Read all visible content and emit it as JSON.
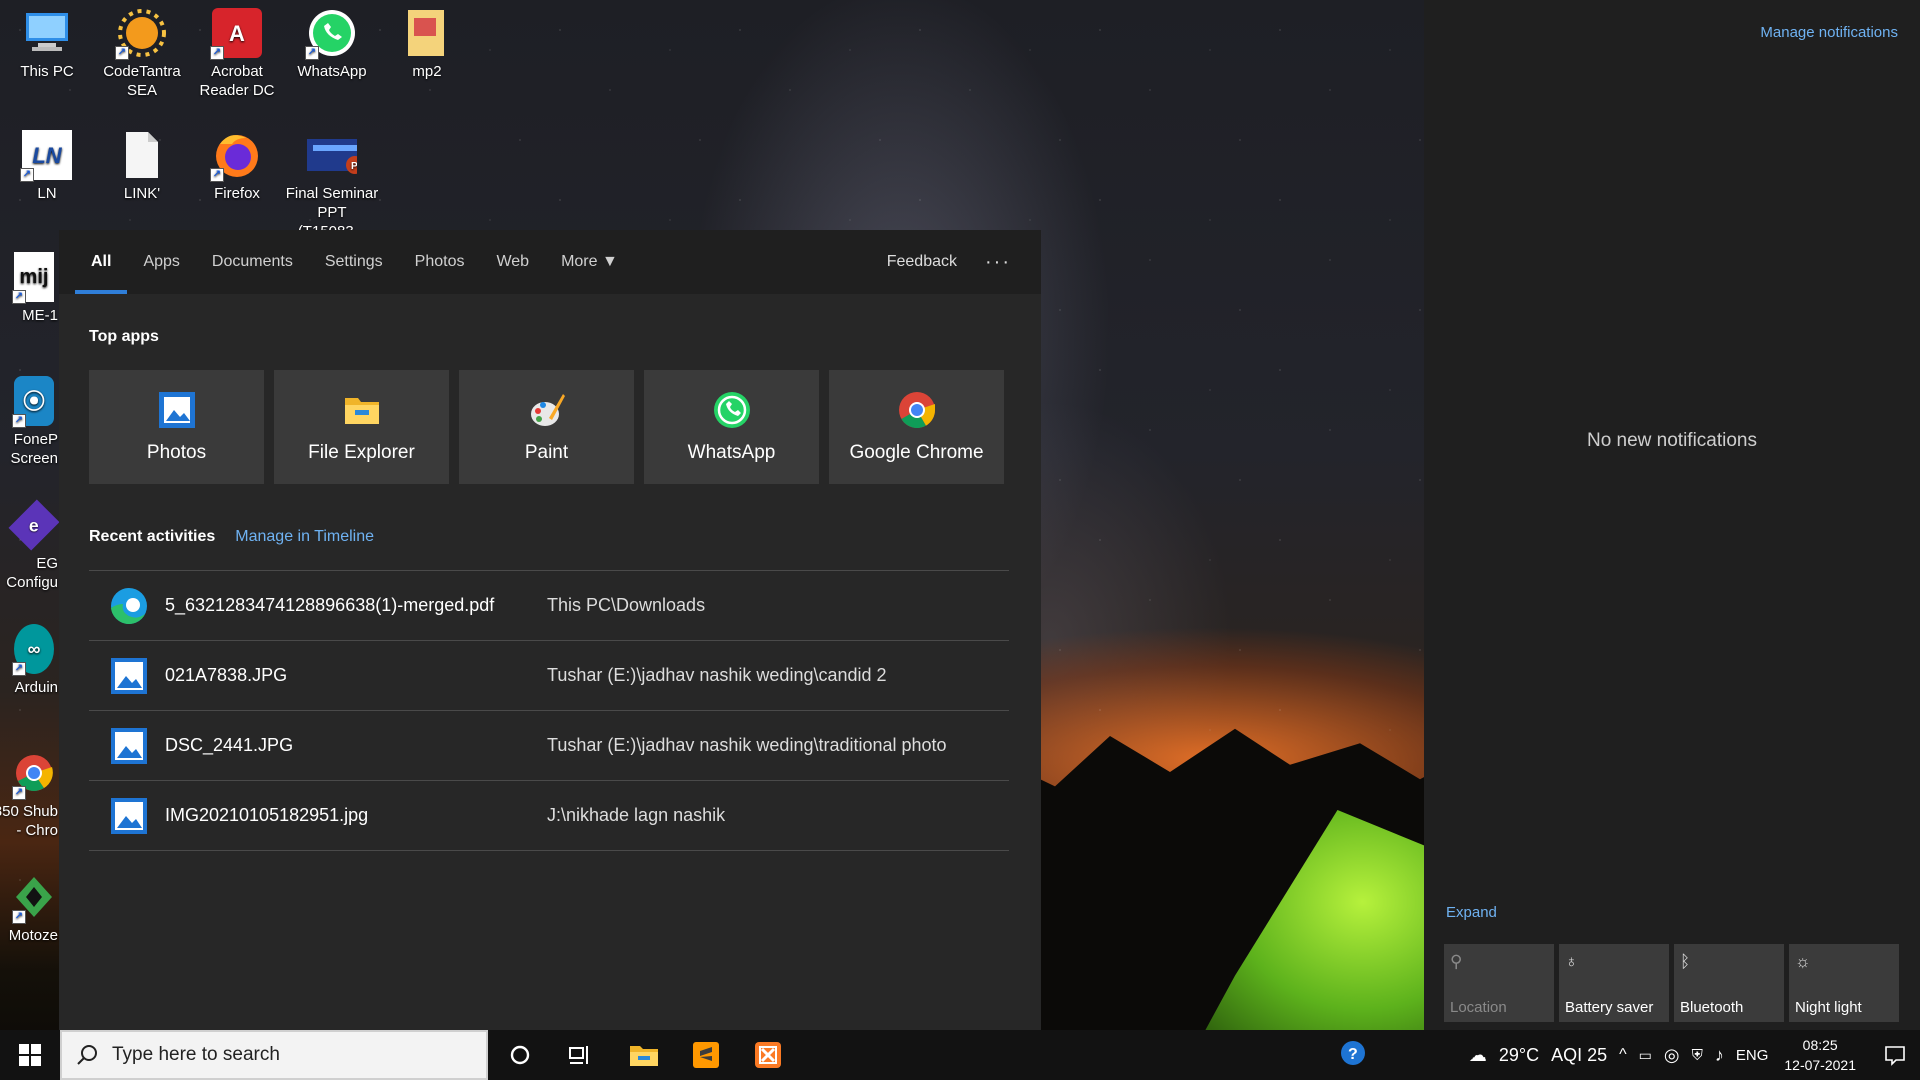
{
  "desktop": {
    "icons": [
      {
        "label": "This PC",
        "icon": "this-pc-icon"
      },
      {
        "label": "CodeTantra SEA",
        "icon": "codetantra-icon"
      },
      {
        "label": "Acrobat Reader DC",
        "icon": "acrobat-icon"
      },
      {
        "label": "WhatsApp",
        "icon": "whatsapp-icon"
      },
      {
        "label": "mp2",
        "icon": "folder-icon"
      },
      {
        "label": "LN",
        "icon": "ln-icon"
      },
      {
        "label": "LINK'",
        "icon": "file-icon"
      },
      {
        "label": "Firefox",
        "icon": "firefox-icon"
      },
      {
        "label": "Final Seminar PPT (T15083...",
        "icon": "powerpoint-icon"
      },
      {
        "label": "ME-1",
        "icon": "mijo-icon"
      },
      {
        "label": "FoneP Screen",
        "icon": "fonepaw-icon"
      },
      {
        "label": "EG Configu",
        "icon": "eg-icon"
      },
      {
        "label": "Arduin",
        "icon": "arduino-icon"
      },
      {
        "label": "850 Shub - Chro",
        "icon": "chrome-icon"
      },
      {
        "label": "Motoze",
        "icon": "motoze-icon"
      }
    ]
  },
  "search_panel": {
    "tabs": [
      {
        "label": "All",
        "active": true
      },
      {
        "label": "Apps"
      },
      {
        "label": "Documents"
      },
      {
        "label": "Settings"
      },
      {
        "label": "Photos"
      },
      {
        "label": "Web"
      },
      {
        "label": "More ▼"
      }
    ],
    "feedback_label": "Feedback",
    "more_options_label": "···",
    "top_apps_title": "Top apps",
    "top_apps": [
      {
        "label": "Photos",
        "icon": "photos-icon"
      },
      {
        "label": "File Explorer",
        "icon": "file-explorer-icon"
      },
      {
        "label": "Paint",
        "icon": "paint-icon"
      },
      {
        "label": "WhatsApp",
        "icon": "whatsapp-icon"
      },
      {
        "label": "Google Chrome",
        "icon": "chrome-icon"
      }
    ],
    "recent_title": "Recent activities",
    "manage_timeline_label": "Manage in Timeline",
    "recent": [
      {
        "name": "5_6321283474128896638(1)-merged.pdf",
        "path": "This PC\\Downloads",
        "icon": "edge-icon"
      },
      {
        "name": "021A7838.JPG",
        "path": "Tushar (E:)\\jadhav nashik weding\\candid 2",
        "icon": "photos-icon"
      },
      {
        "name": "DSC_2441.JPG",
        "path": "Tushar (E:)\\jadhav nashik weding\\traditional photo",
        "icon": "photos-icon"
      },
      {
        "name": "IMG20210105182951.jpg",
        "path": "J:\\nikhade lagn nashik",
        "icon": "photos-icon"
      }
    ]
  },
  "action_center": {
    "manage_label": "Manage notifications",
    "empty_label": "No new notifications",
    "expand_label": "Expand",
    "quick_actions": [
      {
        "label": "Location",
        "icon": "location-icon",
        "enabled": false
      },
      {
        "label": "Battery saver",
        "icon": "battery-saver-icon",
        "enabled": true
      },
      {
        "label": "Bluetooth",
        "icon": "bluetooth-icon",
        "enabled": true
      },
      {
        "label": "Night light",
        "icon": "night-light-icon",
        "enabled": true
      }
    ]
  },
  "taskbar": {
    "search_placeholder": "Type here to search",
    "weather_temp": "29°C",
    "aqi": "AQI 25",
    "language": "ENG",
    "time": "08:25",
    "date": "12-07-2021"
  },
  "colors": {
    "accent": "#2f7ed8",
    "link": "#6fb2f2",
    "panel_bg": "#272727",
    "tile_bg": "#3a3a3a"
  }
}
